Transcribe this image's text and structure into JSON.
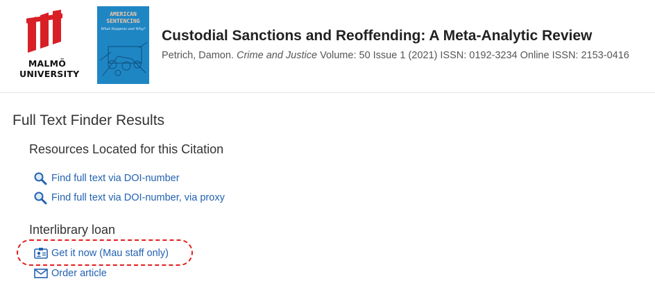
{
  "header": {
    "logo": {
      "line1": "MALMÖ",
      "line2": "UNIVERSITY",
      "brand_color": "#d91f26"
    },
    "cover": {
      "title_line1": "AMERICAN",
      "title_line2": "SENTENCING",
      "subtitle": "What Happens and Why?",
      "color": "#1f86c4"
    },
    "article_title": "Custodial Sanctions and Reoffending: A Meta-Analytic Review",
    "citation": {
      "author": "Petrich, Damon.",
      "journal": "Crime and Justice",
      "details": "Volume: 50 Issue 1 (2021) ISSN: 0192-3234 Online ISSN: 2153-0416"
    }
  },
  "main": {
    "heading": "Full Text Finder Results",
    "resources": {
      "heading": "Resources Located for this Citation",
      "links": [
        {
          "label": "Find full text via DOI-number",
          "icon": "magnifier-icon"
        },
        {
          "label": "Find full text via DOI-number, via proxy",
          "icon": "magnifier-icon"
        }
      ]
    },
    "ill": {
      "heading": "Interlibrary loan",
      "links": [
        {
          "label": "Get it now (Mau staff only)",
          "icon": "id-card-icon"
        },
        {
          "label": "Order article",
          "icon": "envelope-icon"
        }
      ]
    }
  },
  "colors": {
    "link": "#2262b0",
    "highlight": "#e31c1c"
  }
}
